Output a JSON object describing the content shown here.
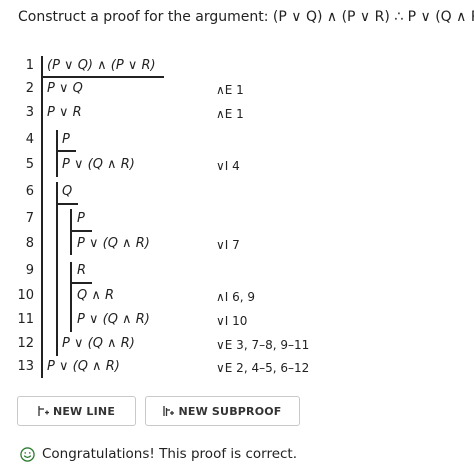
{
  "problem": {
    "prompt": "Construct a proof for the argument: (P ∨ Q) ∧ (P ∨ R) ∴ P ∨ (Q ∧ R)"
  },
  "proof": {
    "lines": [
      {
        "num": "1",
        "formula": "(P ∨ Q) ∧ (P ∨ R)",
        "justification": ""
      },
      {
        "num": "2",
        "formula": "P ∨ Q",
        "justification": "∧E 1"
      },
      {
        "num": "3",
        "formula": "P ∨ R",
        "justification": "∧E 1"
      },
      {
        "num": "4",
        "formula": "P",
        "justification": ""
      },
      {
        "num": "5",
        "formula": "P ∨ (Q ∧ R)",
        "justification": "∨I 4"
      },
      {
        "num": "6",
        "formula": "Q",
        "justification": ""
      },
      {
        "num": "7",
        "formula": "P",
        "justification": ""
      },
      {
        "num": "8",
        "formula": "P ∨ (Q ∧ R)",
        "justification": "∨I 7"
      },
      {
        "num": "9",
        "formula": "R",
        "justification": ""
      },
      {
        "num": "10",
        "formula": "Q ∧ R",
        "justification": "∧I 6, 9"
      },
      {
        "num": "11",
        "formula": "P ∨ (Q ∧ R)",
        "justification": "∨I 10"
      },
      {
        "num": "12",
        "formula": "P ∨ (Q ∧ R)",
        "justification": "∨E 3, 7–8, 9–11"
      },
      {
        "num": "13",
        "formula": "P ∨ (Q ∧ R)",
        "justification": "∨E 2, 4–5, 6–12"
      }
    ]
  },
  "toolbar": {
    "new_line_label": "NEW LINE",
    "new_subproof_label": "NEW SUBPROOF"
  },
  "status": {
    "message": "Congratulations! This proof is correct.",
    "icon": "smiley-icon",
    "color": "#2e7d32"
  }
}
